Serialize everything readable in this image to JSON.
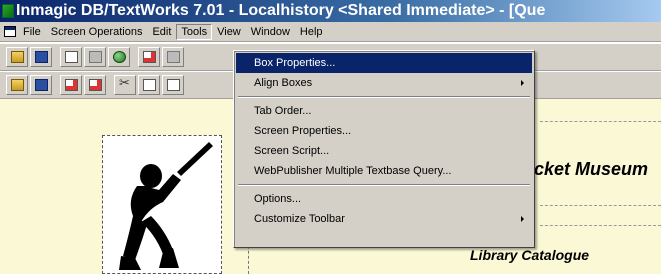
{
  "window": {
    "title": "Inmagic DB/TextWorks 7.01 - Localhistory <Shared Immediate> - [Que"
  },
  "menubar": {
    "items": [
      "File",
      "Screen Operations",
      "Edit",
      "Tools",
      "View",
      "Window",
      "Help"
    ],
    "active": "Tools"
  },
  "tools_menu": {
    "items": [
      {
        "label": "Box Properties...",
        "highlighted": true,
        "submenu": false
      },
      {
        "label": "Align Boxes",
        "highlighted": false,
        "submenu": true
      },
      {
        "label": "Tab Order...",
        "highlighted": false,
        "submenu": false
      },
      {
        "label": "Screen Properties...",
        "highlighted": false,
        "submenu": false
      },
      {
        "label": "Screen Script...",
        "highlighted": false,
        "submenu": false
      },
      {
        "label": "WebPublisher Multiple Textbase Query...",
        "highlighted": false,
        "submenu": false
      },
      {
        "label": "Options...",
        "highlighted": false,
        "submenu": false
      },
      {
        "label": "Customize Toolbar",
        "highlighted": false,
        "submenu": true
      }
    ]
  },
  "toolbar1": {
    "icons": [
      "folder-icon",
      "disk-icon",
      "page-icon",
      "grey-icon",
      "globe-icon",
      "page-red-icon",
      "grey-icon"
    ]
  },
  "toolbar2": {
    "icons": [
      "folder-icon",
      "save-icon",
      "page-red-icon",
      "page-red-icon",
      "scissors-icon",
      "copy-icon",
      "paste-icon"
    ]
  },
  "workspace": {
    "museum_title": "cket Museum",
    "library_label": "Library Catalogue"
  },
  "colors": {
    "titlebar": "#0a246a",
    "menu_highlight": "#0a246a",
    "chrome": "#d4d0c8",
    "workspace_bg": "#fbf8d6"
  }
}
